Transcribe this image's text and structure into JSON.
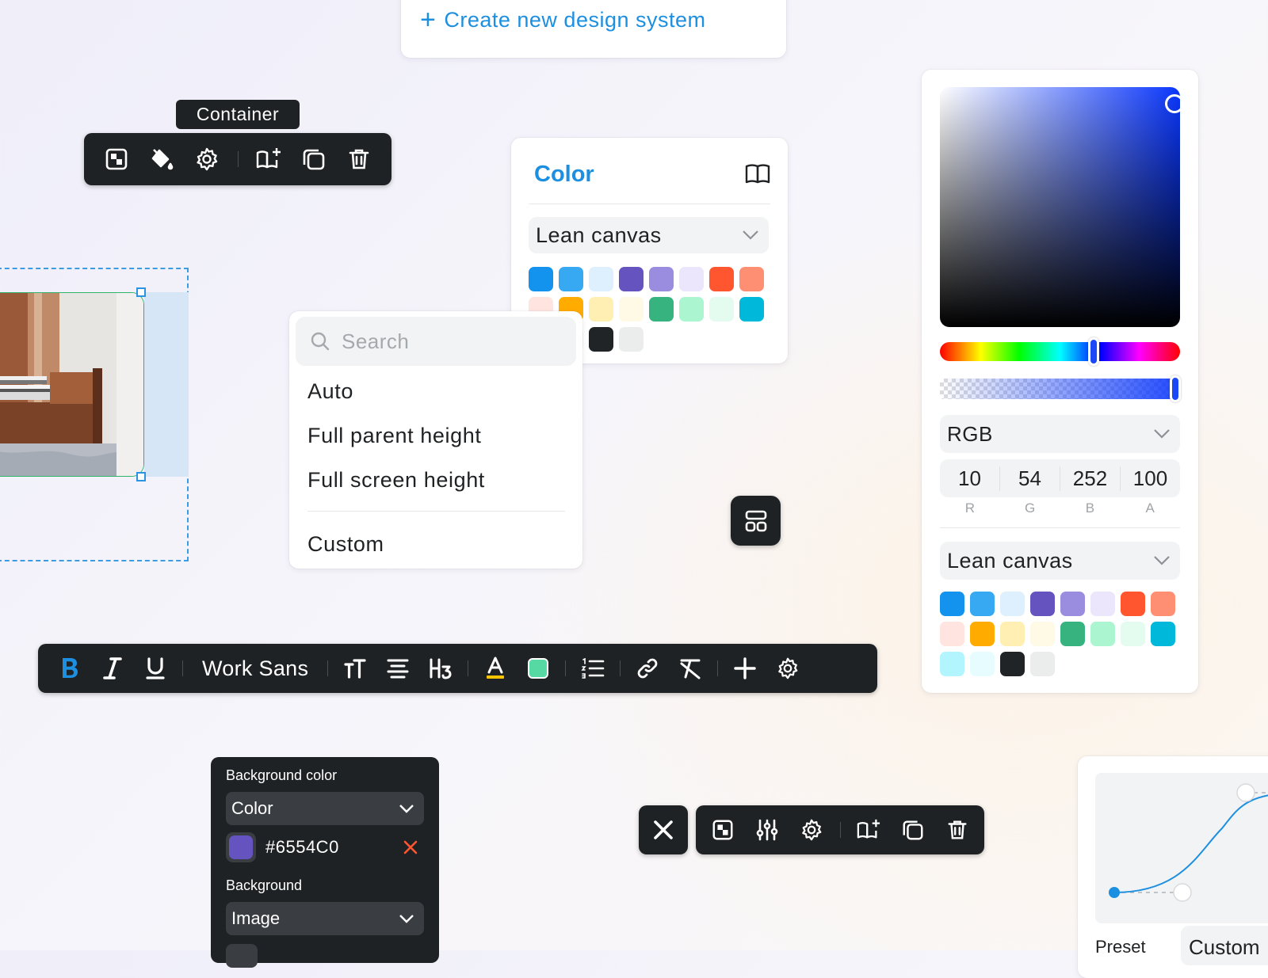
{
  "create": {
    "label": "Create new design system",
    "plus": "+"
  },
  "tooltip": {
    "label": "Container"
  },
  "color_card": {
    "title": "Color",
    "palette_select": "Lean canvas",
    "swatches": [
      "#1493ee",
      "#37a9f3",
      "#def0fd",
      "#6554c0",
      "#9a8cde",
      "#ebe6fc",
      "#ff5630",
      "#ff8f73",
      "#ffe4df",
      "#ffab00",
      "#ffefb2",
      "#fffae6",
      "#36b37e",
      "#abf5d1",
      "#e3fcef",
      "#00b8d9",
      "#b3f5ff",
      "#e6fcff",
      "#212426",
      "#ebecec"
    ]
  },
  "menu": {
    "search_placeholder": "Search",
    "items": [
      "Auto",
      "Full parent height",
      "Full screen height"
    ],
    "custom": "Custom"
  },
  "picker": {
    "mode": "RGB",
    "r": "10",
    "g": "54",
    "b": "252",
    "a": "100",
    "labels": [
      "R",
      "G",
      "B",
      "A"
    ],
    "hue_level": 0.64,
    "alpha_level": 1.0,
    "palette_select": "Lean canvas",
    "swatches": [
      "#1493ee",
      "#37a9f3",
      "#def0fd",
      "#6554c0",
      "#9a8cde",
      "#ebe6fc",
      "#ff5630",
      "#ff8f73",
      "#ffe4df",
      "#ffab00",
      "#ffefb2",
      "#fffae6",
      "#36b37e",
      "#abf5d1",
      "#e3fcef",
      "#00b8d9",
      "#b3f5ff",
      "#e6fcff",
      "#212426",
      "#ebecec"
    ]
  },
  "format_toolbar": {
    "font": "Work Sans",
    "accent": "#1d8fe0",
    "highlight": "#57d9a3",
    "text_underline": "#ffc400"
  },
  "bg_panel": {
    "bg_color_label": "Background color",
    "color_type": "Color",
    "hex": "#6554C0",
    "chip_color": "#6554c0",
    "background_label": "Background",
    "background_type": "Image"
  },
  "ease_card": {
    "preset_label": "Preset",
    "preset_value": "Custom"
  },
  "colors": {
    "accent": "#1d8fe0",
    "dark": "#1f2224",
    "delete_red": "#ff5630"
  }
}
